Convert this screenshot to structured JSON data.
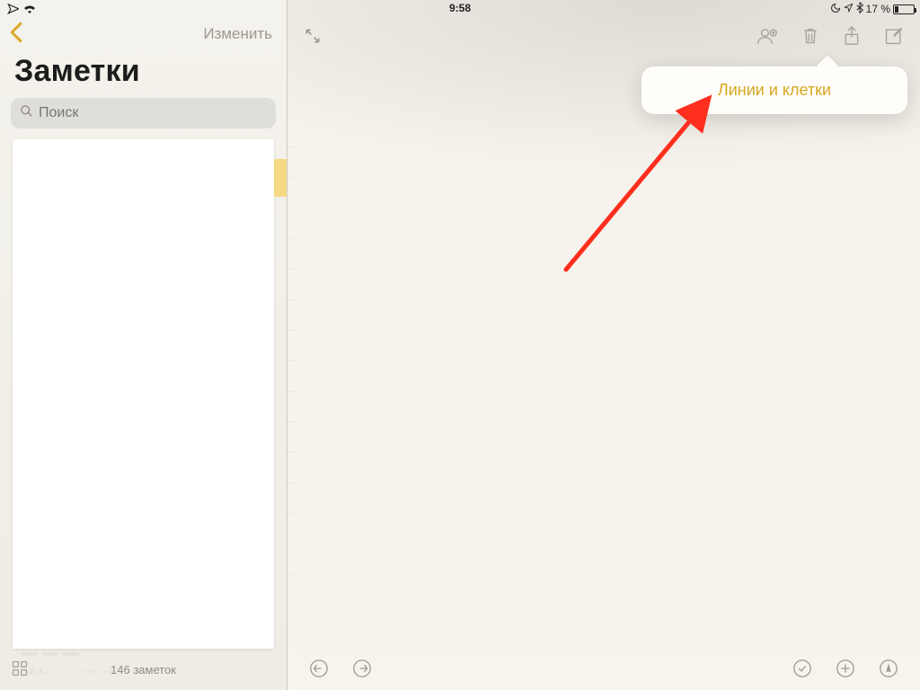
{
  "status": {
    "time": "9:58",
    "battery_text": "17 %"
  },
  "sidebar": {
    "edit_label": "Изменить",
    "title": "Заметки",
    "search_placeholder": "Поиск",
    "footer_count": "146 заметок"
  },
  "popover": {
    "item_label": "Линии и клетки"
  },
  "colors": {
    "accent": "#d7a820",
    "annotation": "#ff2e1f"
  }
}
